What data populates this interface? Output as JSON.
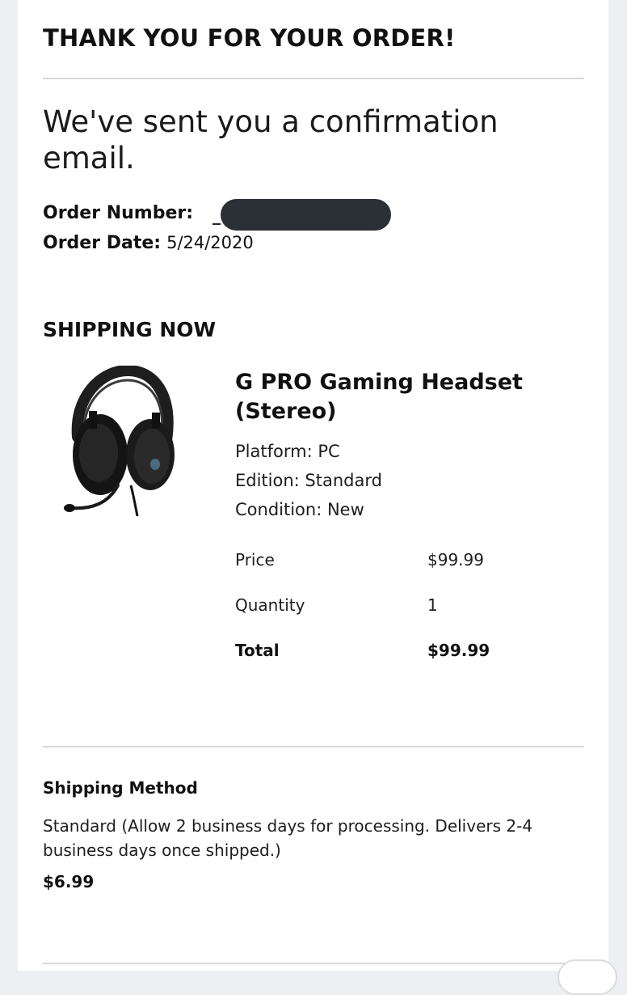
{
  "header": {
    "title": "THANK YOU FOR YOUR ORDER!",
    "confirmation": "We've sent you a confirmation email."
  },
  "order": {
    "number_label": "Order Number:",
    "date_label": "Order Date:",
    "date_value": "5/24/2020"
  },
  "shipping_now": {
    "section_title": "SHIPPING NOW",
    "product": {
      "name": "G PRO Gaming Headset (Stereo)",
      "platform": "Platform: PC",
      "edition": "Edition: Standard",
      "condition": "Condition: New",
      "image_icon": "headset-image"
    },
    "summary": {
      "price_label": "Price",
      "price_value": "$99.99",
      "quantity_label": "Quantity",
      "quantity_value": "1",
      "total_label": "Total",
      "total_value": "$99.99"
    }
  },
  "shipping_method": {
    "title": "Shipping Method",
    "description": "Standard (Allow 2 business days for processing. Delivers 2-4 business days once shipped.)",
    "price": "$6.99"
  },
  "colors": {
    "background": "#eeeff3",
    "card": "#ffffff",
    "divider": "#d9d9d9",
    "redaction": "#2b2f36"
  }
}
